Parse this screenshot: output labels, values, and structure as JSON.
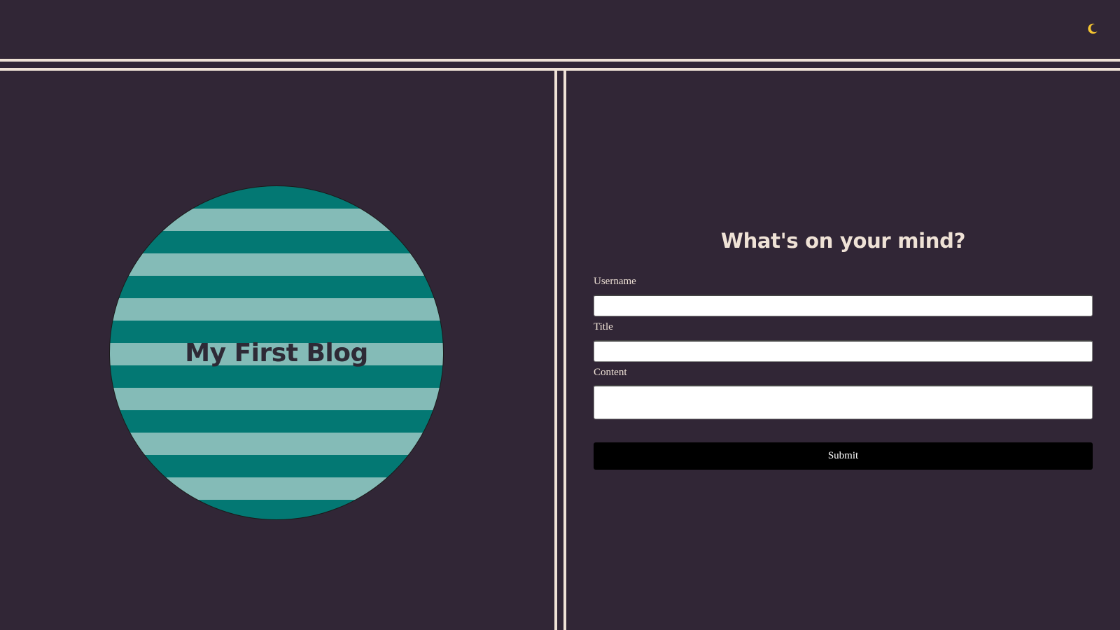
{
  "header": {
    "theme_toggle_icon": "moon-icon",
    "moon_color": "#f4c430"
  },
  "blog": {
    "title": "My First Blog",
    "stripe_colors": [
      "#037873",
      "#84bbb7"
    ]
  },
  "form": {
    "heading": "What's on your mind?",
    "fields": [
      {
        "label": "Username",
        "value": "",
        "placeholder": ""
      },
      {
        "label": "Title",
        "value": "",
        "placeholder": ""
      },
      {
        "label": "Content",
        "value": "",
        "placeholder": ""
      }
    ],
    "submit_label": "Submit"
  },
  "theme": {
    "background": "#312636",
    "accent_line": "#efe2d6"
  }
}
